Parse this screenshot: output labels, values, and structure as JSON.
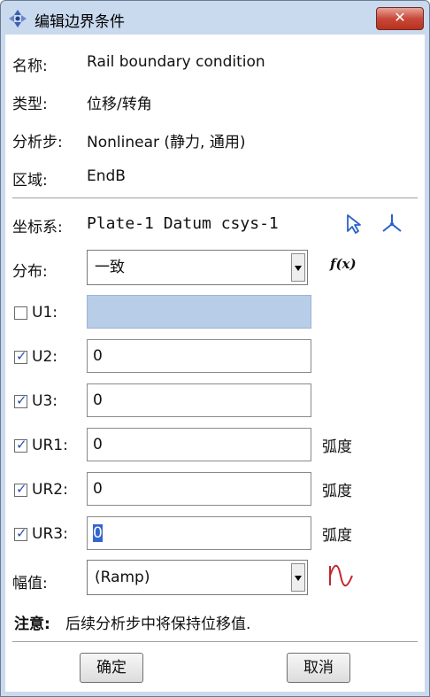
{
  "window": {
    "title": "编辑边界条件",
    "close_label": "✕"
  },
  "info": [
    {
      "label": "名称:",
      "value": "Rail boundary condition"
    },
    {
      "label": "类型:",
      "value": "位移/转角"
    },
    {
      "label": "分析步:",
      "value": "Nonlinear (静力, 通用)"
    },
    {
      "label": "区域:",
      "value": "EndB"
    }
  ],
  "csys": {
    "label": "坐标系:",
    "value": "Plate-1 Datum csys-1"
  },
  "distribution": {
    "label": "分布:",
    "selected": "一致",
    "fx_label": "f(x)"
  },
  "dofs": [
    {
      "label": "U1:",
      "checked": false,
      "value": "",
      "unit": ""
    },
    {
      "label": "U2:",
      "checked": true,
      "value": "0",
      "unit": ""
    },
    {
      "label": "U3:",
      "checked": true,
      "value": "0",
      "unit": ""
    },
    {
      "label": "UR1:",
      "checked": true,
      "value": "0",
      "unit": "弧度"
    },
    {
      "label": "UR2:",
      "checked": true,
      "value": "0",
      "unit": "弧度"
    },
    {
      "label": "UR3:",
      "checked": true,
      "value": "0",
      "unit": "弧度"
    }
  ],
  "amplitude": {
    "label": "幅值:",
    "selected": "(Ramp)"
  },
  "note": {
    "bold": "注意:",
    "text": "后续分析步中将保持位移值."
  },
  "buttons": {
    "ok": "确定",
    "cancel": "取消"
  },
  "colors": {
    "titlebar": "#c9d9ee",
    "close_button": "#c9483a",
    "disabled_field": "#b8cde8",
    "icon_blue": "#2a63c8",
    "amplitude_icon": "#c0282d"
  }
}
